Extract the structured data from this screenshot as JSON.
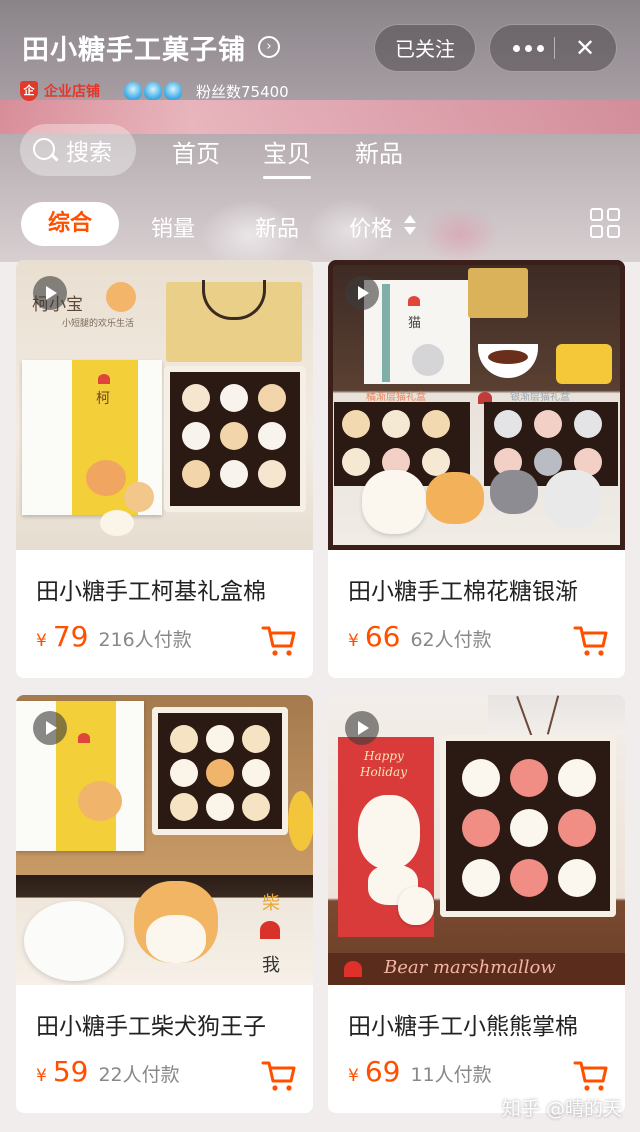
{
  "shop": {
    "name": "田小糖手工菓子铺",
    "follow_label": "已关注",
    "enterprise_label": "企业店铺",
    "enterprise_mark": "企",
    "fans": "粉丝数75400"
  },
  "capsule": {
    "more_icon": "more-dots-icon",
    "close_icon": "close-icon",
    "close_glyph": "✕"
  },
  "nav": {
    "search_label": "搜索",
    "tabs": [
      "首页",
      "宝贝",
      "新品"
    ],
    "active_tab": "宝贝"
  },
  "sort": {
    "items": [
      "综合",
      "销量",
      "新品",
      "价格"
    ],
    "active": "综合",
    "layout_icon": "grid-view-icon"
  },
  "products": [
    {
      "name": "田小糖手工柯基礼盒棉",
      "currency": "¥",
      "price": "79",
      "sold": "216人付款",
      "photo_text": [
        "柯小宝",
        "小短腿的欢乐生活",
        "柯"
      ]
    },
    {
      "name": "田小糖手工棉花糖银渐",
      "currency": "¥",
      "price": "66",
      "sold": "62人付款",
      "photo_text": [
        "猫",
        "橘渐层猫礼盒",
        "银渐层猫礼盒"
      ]
    },
    {
      "name": "田小糖手工柴犬狗王子",
      "currency": "¥",
      "price": "59",
      "sold": "22人付款",
      "photo_text": [
        "柴",
        "我"
      ]
    },
    {
      "name": "田小糖手工小熊熊掌棉",
      "currency": "¥",
      "price": "69",
      "sold": "11人付款",
      "photo_text": [
        "Happy",
        "Holiday",
        "Bear  marshmallow"
      ]
    }
  ],
  "watermark": "知乎 @晴的天",
  "colors": {
    "accent": "#ff5000",
    "enterprise_red": "#e8352a",
    "card_bg": "#ffffff"
  }
}
